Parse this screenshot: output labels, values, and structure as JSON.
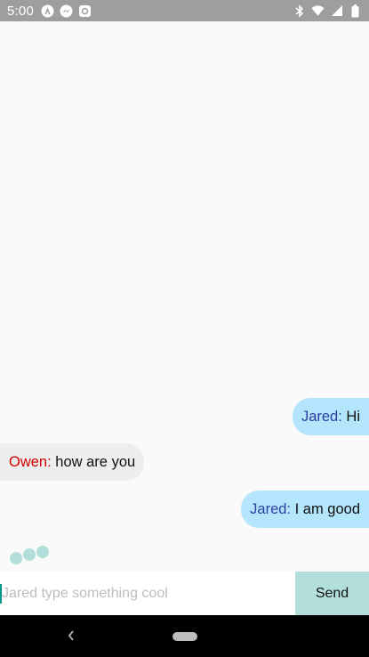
{
  "status_bar": {
    "time": "5:00",
    "left_icons": [
      "android-auto-icon",
      "messenger-icon",
      "app-icon"
    ],
    "right_icons": [
      "bluetooth-icon",
      "wifi-icon",
      "signal-icon",
      "battery-icon"
    ]
  },
  "messages": [
    {
      "sender": "Jared:",
      "text": "Hi",
      "side": "right"
    },
    {
      "sender": "Owen:",
      "text": "how are you",
      "side": "left"
    },
    {
      "sender": "Jared:",
      "text": "I am good",
      "side": "right"
    }
  ],
  "typing_indicator": {
    "icon": "typing-dots-icon"
  },
  "composer": {
    "placeholder": "Jared type something cool",
    "value": "",
    "send_label": "Send"
  },
  "nav_bar": {
    "icons": [
      "back-icon",
      "home-pill-icon"
    ]
  },
  "colors": {
    "status_bar": "#9e9e9e",
    "background": "#fafafa",
    "bubble_self": "#b3e5fc",
    "bubble_other": "#eeeeee",
    "sender_self": "#303f9f",
    "sender_other": "#d50000",
    "send_button": "#b2dfdb",
    "typing_dots": "#b2dfdb"
  }
}
